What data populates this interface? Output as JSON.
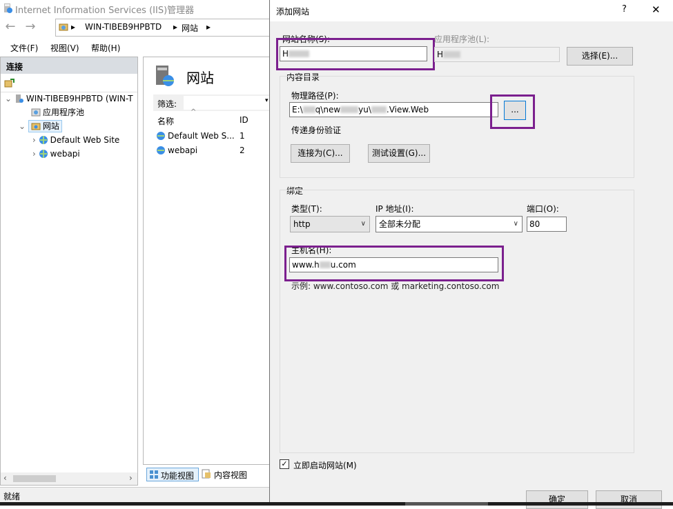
{
  "iis": {
    "window_title": "Internet Information Services (IIS)管理器",
    "breadcrumb": [
      "WIN-TIBEB9HPBTD",
      "网站"
    ],
    "menu": [
      "文件(F)",
      "视图(V)",
      "帮助(H)"
    ],
    "connections": {
      "header": "连接",
      "tree": [
        "WIN-TIBEB9HPBTD (WIN-T",
        "应用程序池",
        "网站",
        "Default Web Site",
        "webapi"
      ]
    },
    "sites": {
      "title": "网站",
      "filter_label": "筛选:",
      "columns": [
        "名称",
        "ID"
      ],
      "rows": [
        {
          "name": "Default Web S...",
          "id": "1"
        },
        {
          "name": "webapi",
          "id": "2"
        }
      ]
    },
    "view_tabs": [
      "功能视图",
      "内容视图"
    ],
    "status": "就绪"
  },
  "dialog": {
    "title": "添加网站",
    "help": "?",
    "close": "✕",
    "site_name_label": "网站名称(S):",
    "site_name_value": "H",
    "app_pool_label": "应用程序池(L):",
    "app_pool_value": "H",
    "select_button": "选择(E)...",
    "content_dir_label": "内容目录",
    "physical_path_label": "物理路径(P):",
    "physical_path_value": "E:\\",
    "physical_path_tail": "q\\new",
    "physical_path_tail2": "yu\\",
    "physical_path_tail3": ".View.Web",
    "browse_button": "...",
    "pass_through_label": "传递身份验证",
    "connect_as_button": "连接为(C)...",
    "test_settings_button": "测试设置(G)...",
    "binding_label": "绑定",
    "type_label": "类型(T):",
    "type_value": "http",
    "ip_label": "IP 地址(I):",
    "ip_value": "全部未分配",
    "port_label": "端口(O):",
    "port_value": "80",
    "hostname_label": "主机名(H):",
    "hostname_value": "www.h",
    "hostname_tail": "u.com",
    "example_text": "示例: www.contoso.com 或 marketing.contoso.com",
    "start_checkbox_label": "立即启动网站(M)",
    "start_checked": true,
    "ok_button": "确定",
    "cancel_button": "取消"
  },
  "colors": {
    "highlight": "#7b1f8e",
    "focus": "#0078d7"
  }
}
